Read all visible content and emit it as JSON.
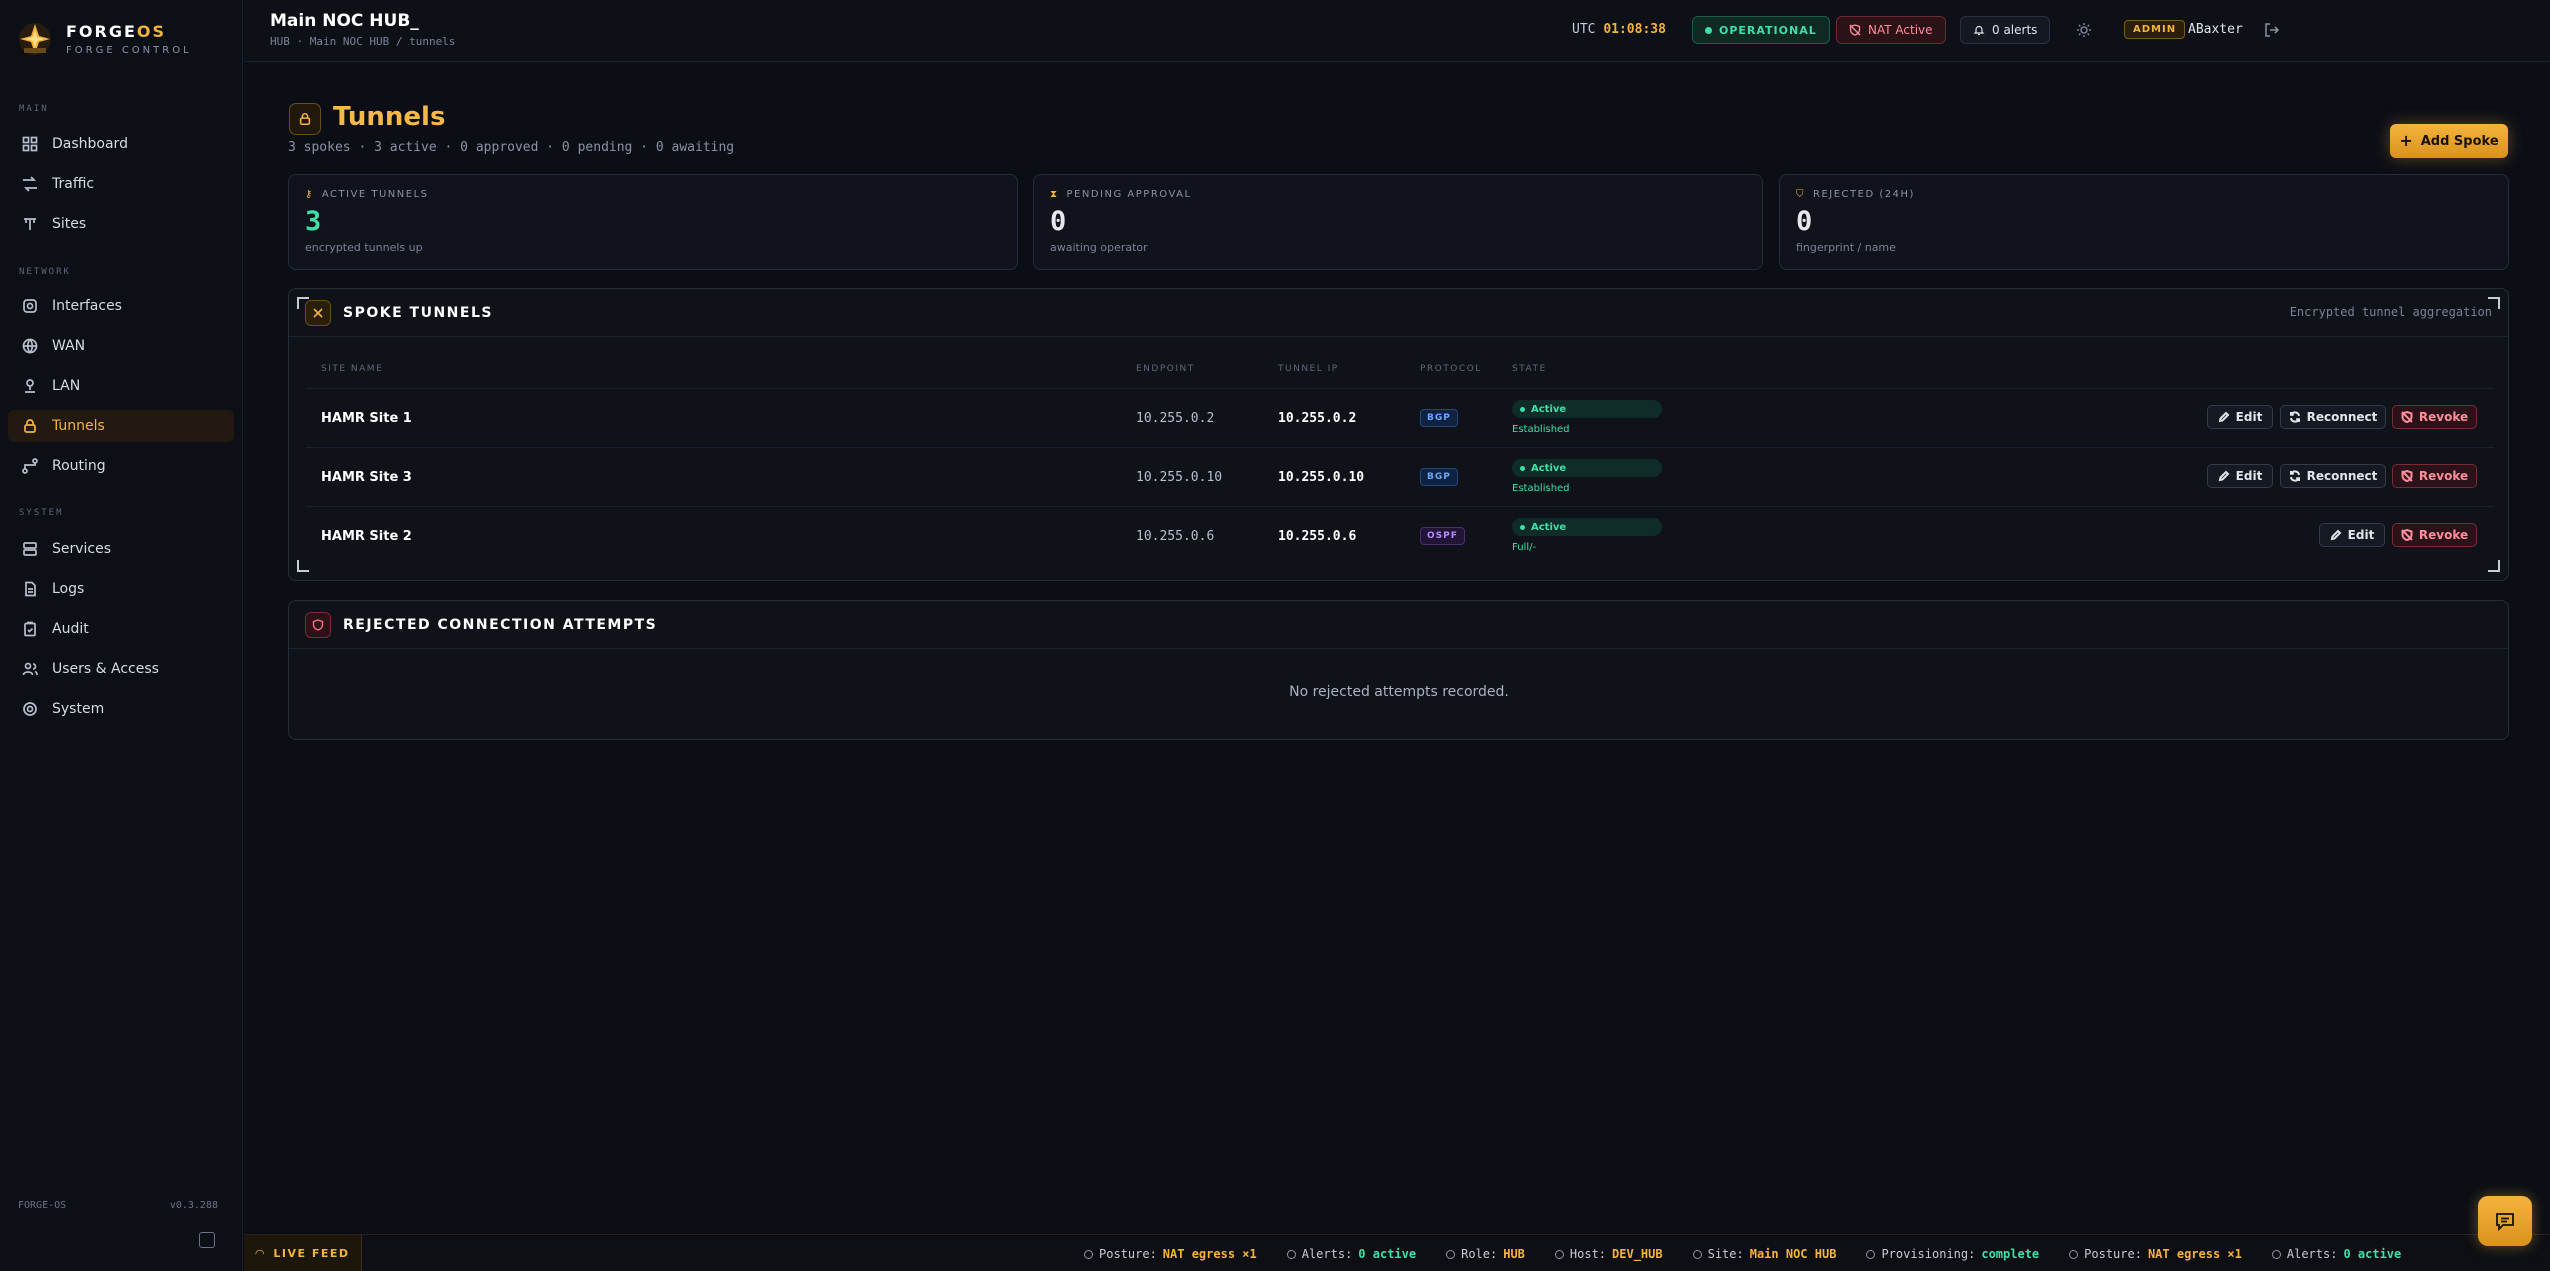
{
  "brand": {
    "name_main": "FORGE",
    "name_accent": "OS",
    "tagline": "FORGE CONTROL"
  },
  "sidebar": {
    "sections": [
      "MAIN",
      "NETWORK",
      "SYSTEM"
    ],
    "items": [
      {
        "label": "Dashboard",
        "icon": "dashboard-icon"
      },
      {
        "label": "Traffic",
        "icon": "traffic-icon"
      },
      {
        "label": "Sites",
        "icon": "sites-icon"
      },
      {
        "label": "Interfaces",
        "icon": "interfaces-icon"
      },
      {
        "label": "WAN",
        "icon": "globe-icon"
      },
      {
        "label": "LAN",
        "icon": "lan-icon"
      },
      {
        "label": "Tunnels",
        "icon": "lock-icon"
      },
      {
        "label": "Routing",
        "icon": "routing-icon"
      },
      {
        "label": "Services",
        "icon": "services-icon"
      },
      {
        "label": "Logs",
        "icon": "logs-icon"
      },
      {
        "label": "Audit",
        "icon": "audit-icon"
      },
      {
        "label": "Users & Access",
        "icon": "users-icon"
      },
      {
        "label": "System",
        "icon": "gear-icon"
      }
    ],
    "footer_name": "FORGE-OS",
    "footer_version": "v0.3.288"
  },
  "header": {
    "title": "Main NOC HUB_",
    "breadcrumb": "HUB · Main NOC HUB / tunnels",
    "utc_label": "UTC",
    "utc_time": "01:08:38",
    "status": "OPERATIONAL",
    "nat": "NAT Active",
    "alerts": "0 alerts",
    "role_badge": "ADMIN",
    "user": "ABaxter"
  },
  "page": {
    "title": "Tunnels",
    "subtitle": "3 spokes · 3 active · 0 approved · 0 pending · 0 awaiting",
    "add_button": "Add Spoke"
  },
  "stats": [
    {
      "label": "ACTIVE TUNNELS",
      "value": "3",
      "desc": "encrypted tunnels up",
      "color": "#3ee0a8"
    },
    {
      "label": "PENDING APPROVAL",
      "value": "0",
      "desc": "awaiting operator",
      "color": "#ffffff"
    },
    {
      "label": "REJECTED (24H)",
      "value": "0",
      "desc": "fingerprint / name",
      "color": "#ffffff"
    }
  ],
  "spoke_panel": {
    "title": "SPOKE TUNNELS",
    "right_note": "Encrypted tunnel aggregation",
    "columns": [
      "SITE NAME",
      "ENDPOINT",
      "TUNNEL IP",
      "PROTOCOL",
      "STATE"
    ],
    "rows": [
      {
        "site": "HAMR Site 1",
        "endpoint": "10.255.0.2",
        "tunnel_ip": "10.255.0.2",
        "protocol": "BGP",
        "state": "Active",
        "state_sub": "Established",
        "actions": [
          "Edit",
          "Reconnect",
          "Revoke"
        ]
      },
      {
        "site": "HAMR Site 3",
        "endpoint": "10.255.0.10",
        "tunnel_ip": "10.255.0.10",
        "protocol": "BGP",
        "state": "Active",
        "state_sub": "Established",
        "actions": [
          "Edit",
          "Reconnect",
          "Revoke"
        ]
      },
      {
        "site": "HAMR Site 2",
        "endpoint": "10.255.0.6",
        "tunnel_ip": "10.255.0.6",
        "protocol": "OSPF",
        "state": "Active",
        "state_sub": "Full/-",
        "actions": [
          "Edit",
          "Revoke"
        ]
      }
    ]
  },
  "rejected_panel": {
    "title": "REJECTED CONNECTION ATTEMPTS",
    "empty": "No rejected attempts recorded."
  },
  "footer": {
    "live": "LIVE FEED",
    "ticker": [
      {
        "label": "Posture:",
        "value": "NAT egress ×1",
        "tone": "amber"
      },
      {
        "label": "Alerts:",
        "value": "0 active",
        "tone": "green"
      },
      {
        "label": "Role:",
        "value": "HUB",
        "tone": "amber"
      },
      {
        "label": "Host:",
        "value": "DEV_HUB",
        "tone": "amber"
      },
      {
        "label": "Site:",
        "value": "Main NOC HUB",
        "tone": "amber"
      },
      {
        "label": "Provisioning:",
        "value": "complete",
        "tone": "green"
      },
      {
        "label": "Posture:",
        "value": "NAT egress ×1",
        "tone": "amber"
      },
      {
        "label": "Alerts:",
        "value": "0 active",
        "tone": "green"
      }
    ]
  }
}
